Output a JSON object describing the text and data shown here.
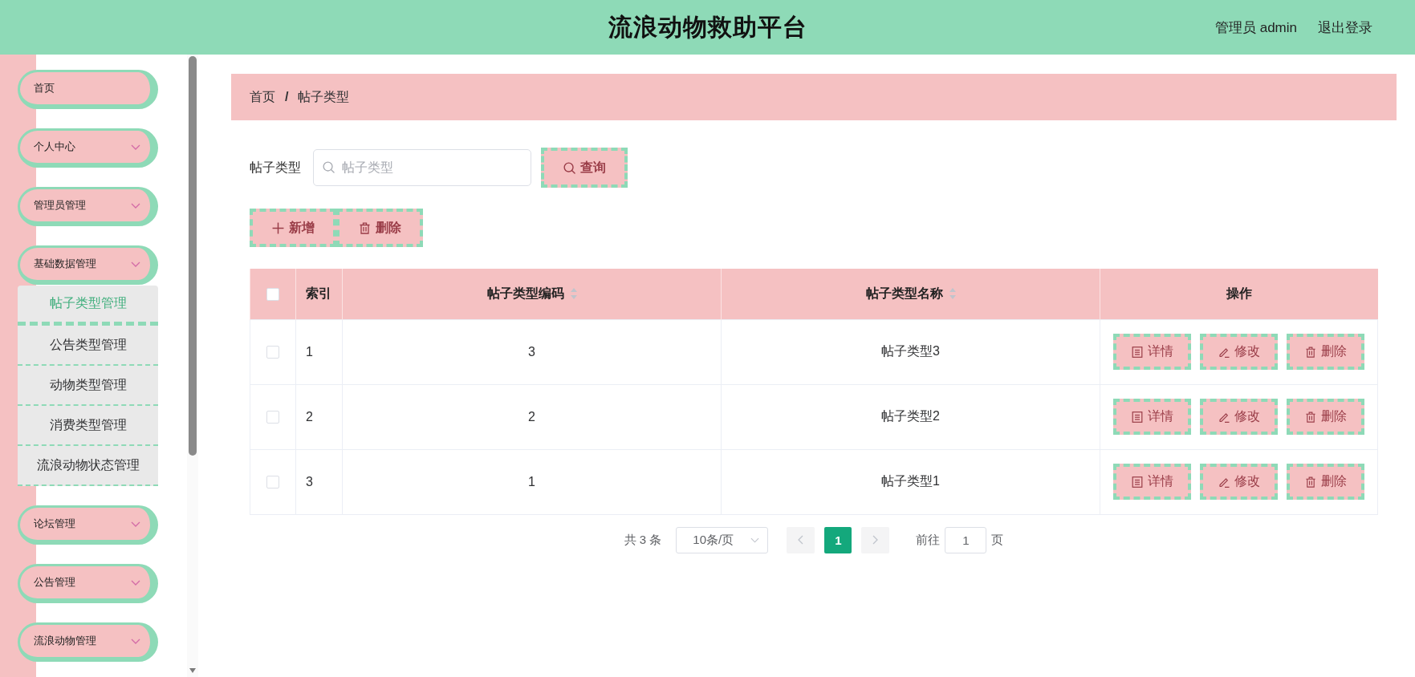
{
  "header": {
    "title": "流浪动物救助平台",
    "user": "管理员 admin",
    "logout": "退出登录"
  },
  "sidebar": {
    "menu": [
      {
        "kind": "link",
        "label": "首页"
      },
      {
        "kind": "submenu",
        "label": "个人中心"
      },
      {
        "kind": "submenu",
        "label": "管理员管理"
      },
      {
        "kind": "submenu",
        "label": "基础数据管理",
        "children": [
          {
            "label": "帖子类型管理",
            "selected": true
          },
          {
            "label": "公告类型管理",
            "selected": false
          },
          {
            "label": "动物类型管理",
            "selected": false
          },
          {
            "label": "消费类型管理",
            "selected": false
          },
          {
            "label": "流浪动物状态管理",
            "selected": false
          }
        ]
      },
      {
        "kind": "submenu",
        "label": "论坛管理"
      },
      {
        "kind": "submenu",
        "label": "公告管理"
      },
      {
        "kind": "submenu",
        "label": "流浪动物管理"
      }
    ]
  },
  "breadcrumb": {
    "items": [
      "首页",
      "帖子类型"
    ],
    "separator": "/"
  },
  "search": {
    "label": "帖子类型",
    "placeholder": "帖子类型",
    "button": "查询"
  },
  "toolbar": [
    {
      "kind": "add",
      "label": "新增"
    },
    {
      "kind": "delete",
      "label": "删除"
    }
  ],
  "table": {
    "select_all": {
      "checked": false
    },
    "columns": [
      {
        "label": "索引",
        "sortable": false
      },
      {
        "label": "帖子类型编码",
        "sortable": true
      },
      {
        "label": "帖子类型名称",
        "sortable": true
      },
      {
        "label": "操作",
        "sortable": false
      }
    ],
    "rows": [
      {
        "checked": false,
        "cells": [
          "1",
          "3",
          "帖子类型3"
        ],
        "actions": [
          {
            "kind": "detail",
            "label": "详情"
          },
          {
            "kind": "edit",
            "label": "修改"
          },
          {
            "kind": "delete",
            "label": "删除"
          }
        ]
      },
      {
        "checked": false,
        "cells": [
          "2",
          "2",
          "帖子类型2"
        ],
        "actions": [
          {
            "kind": "detail",
            "label": "详情"
          },
          {
            "kind": "edit",
            "label": "修改"
          },
          {
            "kind": "delete",
            "label": "删除"
          }
        ]
      },
      {
        "checked": false,
        "cells": [
          "3",
          "1",
          "帖子类型1"
        ],
        "actions": [
          {
            "kind": "detail",
            "label": "详情"
          },
          {
            "kind": "edit",
            "label": "修改"
          },
          {
            "kind": "delete",
            "label": "删除"
          }
        ]
      }
    ]
  },
  "pagination": {
    "total": "共 3 条",
    "page_size": "10条/页",
    "prev_disabled": true,
    "pages": [
      {
        "label": "1",
        "selected": true
      }
    ],
    "next_disabled": true,
    "goto_label": "前往",
    "goto_value": "1",
    "goto_suffix": "页"
  }
}
